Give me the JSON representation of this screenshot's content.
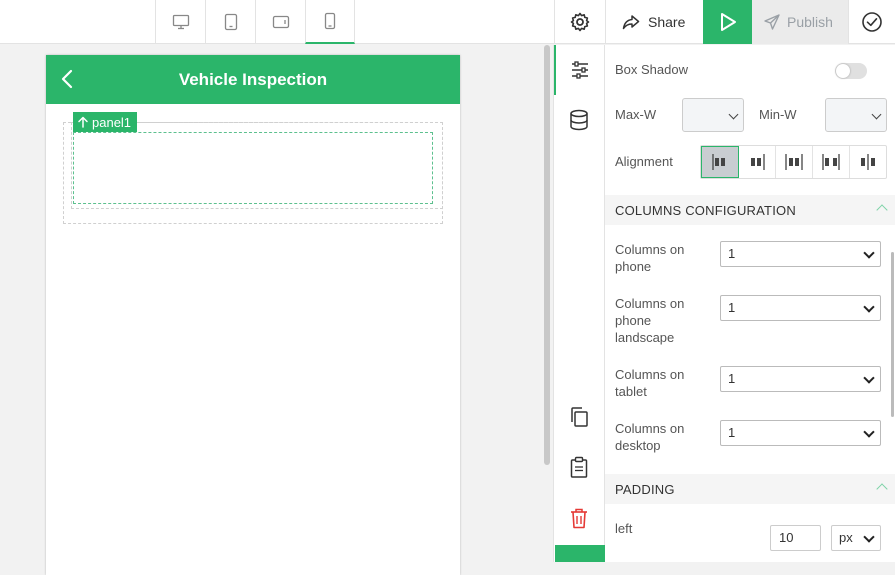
{
  "toolbar": {
    "devices": [
      "desktop",
      "tablet",
      "tablet-landscape",
      "phone"
    ],
    "active_device": "phone",
    "share_label": "Share",
    "publish_label": "Publish"
  },
  "canvas": {
    "screen_title": "Vehicle Inspection",
    "panel_tag": "panel1"
  },
  "properties": {
    "box_shadow_label": "Box Shadow",
    "box_shadow_on": false,
    "max_w_label": "Max-W",
    "min_w_label": "Min-W",
    "max_w_value": "",
    "min_w_value": "",
    "alignment_label": "Alignment",
    "columns_section": "COLUMNS CONFIGURATION",
    "columns": [
      {
        "label": "Columns on phone",
        "value": "1"
      },
      {
        "label": "Columns on phone landscape",
        "value": "1"
      },
      {
        "label": "Columns on tablet",
        "value": "1"
      },
      {
        "label": "Columns on desktop",
        "value": "1"
      }
    ],
    "padding_section": "PADDING",
    "padding_left_label": "left",
    "padding_left_value": "10",
    "padding_left_unit": "px"
  },
  "colors": {
    "accent": "#2bb56a",
    "delete": "#e53935"
  }
}
